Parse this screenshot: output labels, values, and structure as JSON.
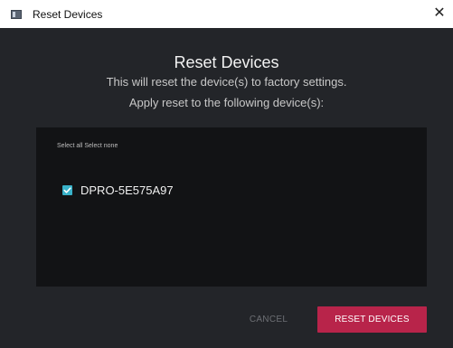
{
  "window": {
    "title": "Reset Devices",
    "close_glyph": "✕"
  },
  "dialog": {
    "heading": "Reset Devices",
    "description_1": "This will reset the device(s) to factory settings.",
    "description_2": "Apply reset to the following device(s):",
    "select_all": "Select all",
    "select_none": "Select none",
    "devices": [
      {
        "label": "DPRO-5E575A97",
        "checked": true
      }
    ],
    "cancel_label": "CANCEL",
    "reset_label": "RESET DEVICES"
  },
  "icons": {
    "app": "app-window-icon",
    "close": "close-icon",
    "check": "check-icon"
  },
  "colors": {
    "dialog_bg": "#232529",
    "panel_bg": "#121315",
    "accent_checkbox": "#39b2c9",
    "primary_button": "#b8244a",
    "cancel_text": "#6d6f74"
  }
}
